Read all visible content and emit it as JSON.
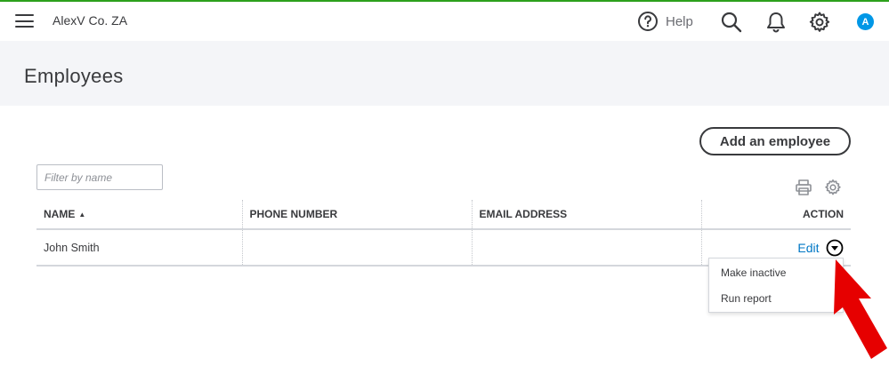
{
  "header": {
    "company": "AlexV Co. ZA",
    "help_label": "Help",
    "avatar_initial": "A",
    "accent_color": "#2ca01c"
  },
  "page": {
    "title": "Employees"
  },
  "toolbar": {
    "add_label": "Add an employee",
    "filter_placeholder": "Filter by name"
  },
  "table": {
    "headers": {
      "name": "NAME",
      "phone": "PHONE NUMBER",
      "email": "EMAIL ADDRESS",
      "action": "ACTION"
    },
    "rows": [
      {
        "name": "John Smith",
        "phone": "",
        "email": "",
        "action_label": "Edit"
      }
    ]
  },
  "dropdown": {
    "items": [
      "Make inactive",
      "Run report"
    ]
  },
  "icons": [
    "menu-icon",
    "help-icon",
    "search-icon",
    "bell-icon",
    "gear-icon",
    "print-icon",
    "settings-icon",
    "caret-down-icon",
    "red-arrow-icon"
  ],
  "colors": {
    "link": "#0077c5",
    "annotation_arrow": "#e60000",
    "avatar": "#0097e6"
  }
}
